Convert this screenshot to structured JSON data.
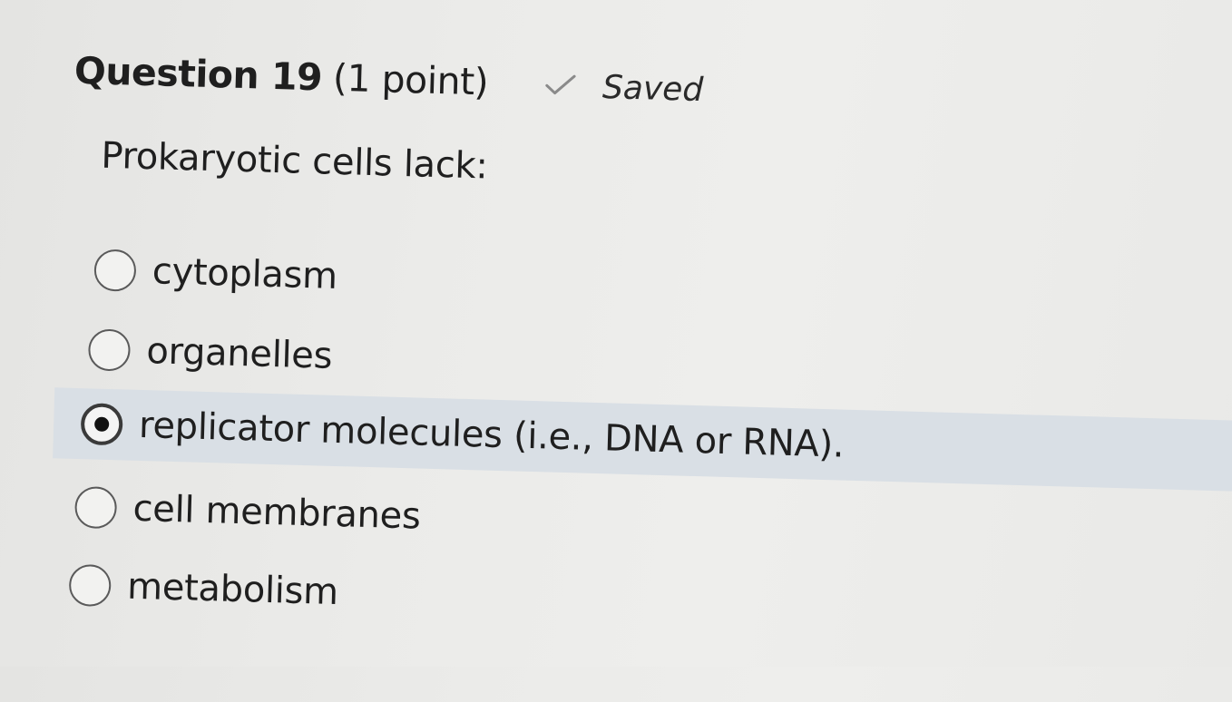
{
  "question": {
    "title": "Question 19",
    "points": "(1 point)",
    "status_label": "Saved",
    "status_icon": "check-icon",
    "prompt": "Prokaryotic cells lack:"
  },
  "options": [
    {
      "label": "cytoplasm",
      "selected": false
    },
    {
      "label": "organelles",
      "selected": false
    },
    {
      "label": "replicator molecules (i.e., DNA or RNA).",
      "selected": true
    },
    {
      "label": "cell membranes",
      "selected": false
    },
    {
      "label": "metabolism",
      "selected": false
    }
  ],
  "colors": {
    "background": "#ebebe9",
    "selected_highlight": "#d9dfe5",
    "text": "#1f1f1f",
    "check": "#8a8a8a"
  }
}
